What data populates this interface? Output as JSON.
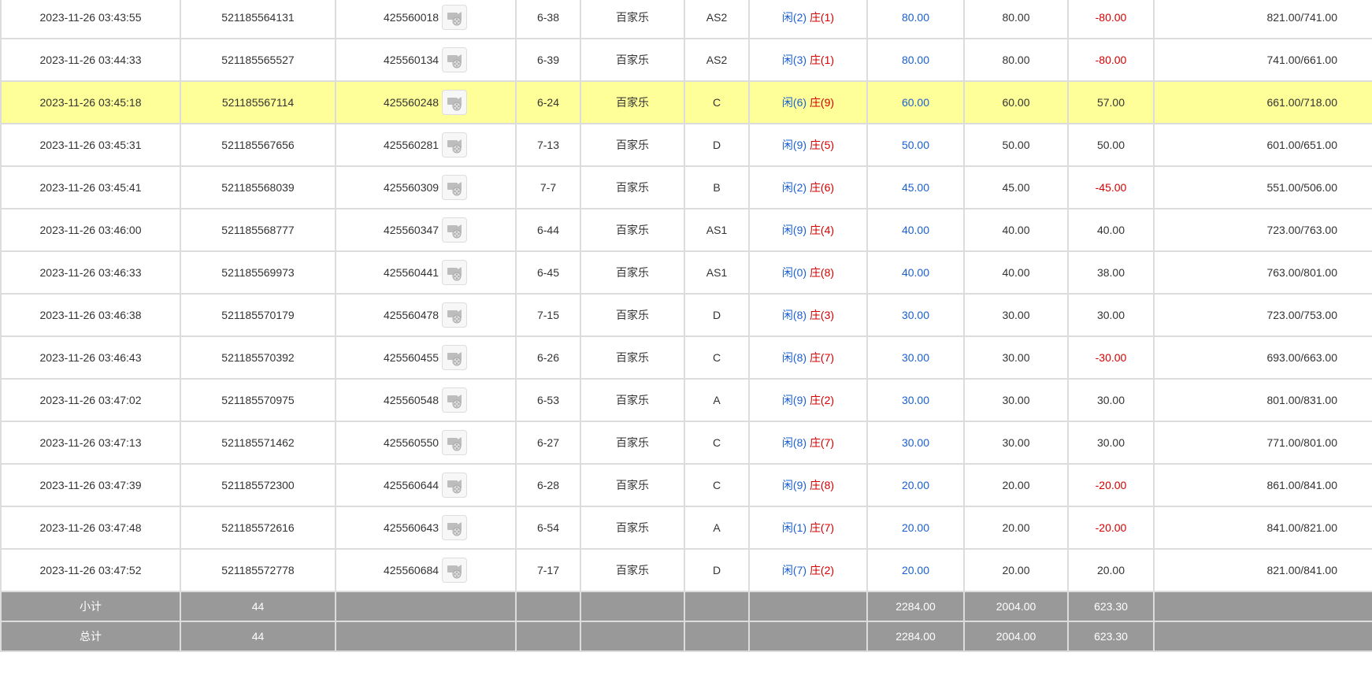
{
  "rows": [
    {
      "time": "2023-11-26 03:43:55",
      "order_id": "521185564131",
      "game_no": "425560018",
      "table": "6-38",
      "game": "百家乐",
      "bet_type": "AS2",
      "result_player": "闲(2)",
      "result_banker": "庄(1)",
      "bet": "80.00",
      "valid_bet": "80.00",
      "win_loss": "-80.00",
      "balance": "821.00/741.00",
      "highlight": false
    },
    {
      "time": "2023-11-26 03:44:33",
      "order_id": "521185565527",
      "game_no": "425560134",
      "table": "6-39",
      "game": "百家乐",
      "bet_type": "AS2",
      "result_player": "闲(3)",
      "result_banker": "庄(1)",
      "bet": "80.00",
      "valid_bet": "80.00",
      "win_loss": "-80.00",
      "balance": "741.00/661.00",
      "highlight": false
    },
    {
      "time": "2023-11-26 03:45:18",
      "order_id": "521185567114",
      "game_no": "425560248",
      "table": "6-24",
      "game": "百家乐",
      "bet_type": "C",
      "result_player": "闲(6)",
      "result_banker": "庄(9)",
      "bet": "60.00",
      "valid_bet": "60.00",
      "win_loss": "57.00",
      "balance": "661.00/718.00",
      "highlight": true
    },
    {
      "time": "2023-11-26 03:45:31",
      "order_id": "521185567656",
      "game_no": "425560281",
      "table": "7-13",
      "game": "百家乐",
      "bet_type": "D",
      "result_player": "闲(9)",
      "result_banker": "庄(5)",
      "bet": "50.00",
      "valid_bet": "50.00",
      "win_loss": "50.00",
      "balance": "601.00/651.00",
      "highlight": false
    },
    {
      "time": "2023-11-26 03:45:41",
      "order_id": "521185568039",
      "game_no": "425560309",
      "table": "7-7",
      "game": "百家乐",
      "bet_type": "B",
      "result_player": "闲(2)",
      "result_banker": "庄(6)",
      "bet": "45.00",
      "valid_bet": "45.00",
      "win_loss": "-45.00",
      "balance": "551.00/506.00",
      "highlight": false
    },
    {
      "time": "2023-11-26 03:46:00",
      "order_id": "521185568777",
      "game_no": "425560347",
      "table": "6-44",
      "game": "百家乐",
      "bet_type": "AS1",
      "result_player": "闲(9)",
      "result_banker": "庄(4)",
      "bet": "40.00",
      "valid_bet": "40.00",
      "win_loss": "40.00",
      "balance": "723.00/763.00",
      "highlight": false
    },
    {
      "time": "2023-11-26 03:46:33",
      "order_id": "521185569973",
      "game_no": "425560441",
      "table": "6-45",
      "game": "百家乐",
      "bet_type": "AS1",
      "result_player": "闲(0)",
      "result_banker": "庄(8)",
      "bet": "40.00",
      "valid_bet": "40.00",
      "win_loss": "38.00",
      "balance": "763.00/801.00",
      "highlight": false
    },
    {
      "time": "2023-11-26 03:46:38",
      "order_id": "521185570179",
      "game_no": "425560478",
      "table": "7-15",
      "game": "百家乐",
      "bet_type": "D",
      "result_player": "闲(8)",
      "result_banker": "庄(3)",
      "bet": "30.00",
      "valid_bet": "30.00",
      "win_loss": "30.00",
      "balance": "723.00/753.00",
      "highlight": false
    },
    {
      "time": "2023-11-26 03:46:43",
      "order_id": "521185570392",
      "game_no": "425560455",
      "table": "6-26",
      "game": "百家乐",
      "bet_type": "C",
      "result_player": "闲(8)",
      "result_banker": "庄(7)",
      "bet": "30.00",
      "valid_bet": "30.00",
      "win_loss": "-30.00",
      "balance": "693.00/663.00",
      "highlight": false
    },
    {
      "time": "2023-11-26 03:47:02",
      "order_id": "521185570975",
      "game_no": "425560548",
      "table": "6-53",
      "game": "百家乐",
      "bet_type": "A",
      "result_player": "闲(9)",
      "result_banker": "庄(2)",
      "bet": "30.00",
      "valid_bet": "30.00",
      "win_loss": "30.00",
      "balance": "801.00/831.00",
      "highlight": false
    },
    {
      "time": "2023-11-26 03:47:13",
      "order_id": "521185571462",
      "game_no": "425560550",
      "table": "6-27",
      "game": "百家乐",
      "bet_type": "C",
      "result_player": "闲(8)",
      "result_banker": "庄(7)",
      "bet": "30.00",
      "valid_bet": "30.00",
      "win_loss": "30.00",
      "balance": "771.00/801.00",
      "highlight": false
    },
    {
      "time": "2023-11-26 03:47:39",
      "order_id": "521185572300",
      "game_no": "425560644",
      "table": "6-28",
      "game": "百家乐",
      "bet_type": "C",
      "result_player": "闲(9)",
      "result_banker": "庄(8)",
      "bet": "20.00",
      "valid_bet": "20.00",
      "win_loss": "-20.00",
      "balance": "861.00/841.00",
      "highlight": false
    },
    {
      "time": "2023-11-26 03:47:48",
      "order_id": "521185572616",
      "game_no": "425560643",
      "table": "6-54",
      "game": "百家乐",
      "bet_type": "A",
      "result_player": "闲(1)",
      "result_banker": "庄(7)",
      "bet": "20.00",
      "valid_bet": "20.00",
      "win_loss": "-20.00",
      "balance": "841.00/821.00",
      "highlight": false
    },
    {
      "time": "2023-11-26 03:47:52",
      "order_id": "521185572778",
      "game_no": "425560684",
      "table": "7-17",
      "game": "百家乐",
      "bet_type": "D",
      "result_player": "闲(7)",
      "result_banker": "庄(2)",
      "bet": "20.00",
      "valid_bet": "20.00",
      "win_loss": "20.00",
      "balance": "821.00/841.00",
      "highlight": false
    }
  ],
  "summary": [
    {
      "label": "小计",
      "count": "44",
      "bet": "2284.00",
      "valid_bet": "2004.00",
      "win_loss": "623.30"
    },
    {
      "label": "总计",
      "count": "44",
      "bet": "2284.00",
      "valid_bet": "2004.00",
      "win_loss": "623.30"
    }
  ],
  "icons": {
    "video": "video-replay-icon"
  },
  "colors": {
    "player": "#1a5fd0",
    "banker": "#d40000",
    "highlight": "#ffff99",
    "summary_bg": "#999999"
  }
}
